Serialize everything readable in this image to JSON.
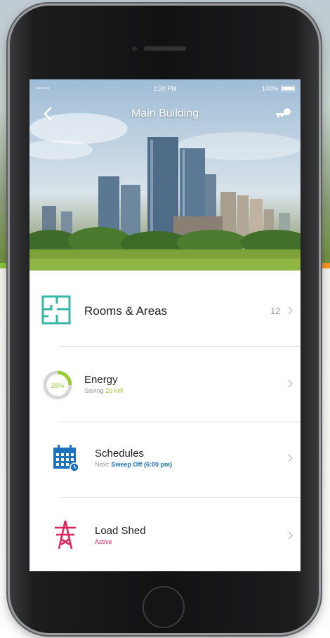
{
  "colors": {
    "rooms_teal": "#34b7a7",
    "energy_green": "#9acd32",
    "schedule_blue": "#1e73be",
    "loadshed_pink": "#e0245e"
  },
  "status_bar": {
    "signal": "•••••",
    "time": "1:20 PM",
    "battery": "100%"
  },
  "nav": {
    "title": "Main Building",
    "back_icon": "chevron-left-icon",
    "action_icon": "key-icon"
  },
  "menu": {
    "rooms": {
      "label": "Rooms & Areas",
      "count": "12",
      "icon": "floorplan-icon"
    },
    "energy": {
      "label": "Energy",
      "subtitle_prefix": "Saving",
      "subtitle_value": "20 kW",
      "gauge_text": "25%",
      "icon": "gauge-icon"
    },
    "schedules": {
      "label": "Schedules",
      "subtitle_prefix": "Next:",
      "subtitle_value": "Sweep Off (6:00 pm)",
      "icon": "calendar-icon"
    },
    "load_shed": {
      "label": "Load Shed",
      "subtitle": "Active",
      "icon": "power-tower-icon"
    }
  }
}
